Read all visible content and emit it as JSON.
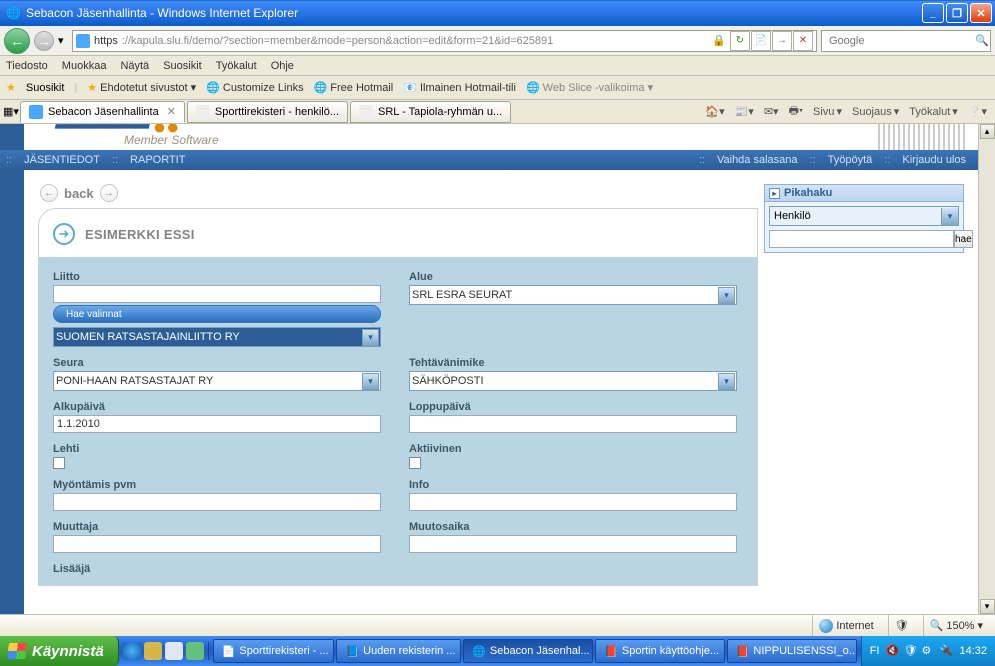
{
  "window": {
    "title": "Sebacon Jäsenhallinta - Windows Internet Explorer"
  },
  "addressbar": {
    "prefix": "https",
    "url": "://kapula.slu.fi/demo/?section=member&mode=person&action=edit&form=21&id=625891"
  },
  "searchbox": {
    "placeholder": "Google"
  },
  "ie_menu": [
    "Tiedosto",
    "Muokkaa",
    "Näytä",
    "Suosikit",
    "Työkalut",
    "Ohje"
  ],
  "favbar": {
    "label": "Suosikit",
    "items": [
      "Ehdotetut sivustot ▾",
      "Customize Links",
      "Free Hotmail",
      "Ilmainen Hotmail-tili",
      "Web Slice -valikoima ▾"
    ]
  },
  "tabs": [
    {
      "label": "Sebacon Jäsenhallinta",
      "active": true
    },
    {
      "label": "Sporttirekisteri - henkilö...",
      "active": false
    },
    {
      "label": "SRL - Tapiola-ryhmän u...",
      "active": false
    }
  ],
  "ie_tools": {
    "sivu": "Sivu",
    "suojaus": "Suojaus",
    "tyokalut": "Työkalut"
  },
  "app_logo_sub": "Member Software",
  "app_menu_left": [
    "JÄSENTIEDOT",
    "RAPORTIT"
  ],
  "app_menu_right": [
    "Vaihda salasana",
    "Työpöytä",
    "Kirjaudu ulos"
  ],
  "back_label": "back",
  "card_title": "ESIMERKKI ESSI",
  "form": {
    "liitto": {
      "label": "Liitto",
      "value": "",
      "hae_btn": "Hae valinnat",
      "select": "SUOMEN RATSASTAJAINLIITTO RY"
    },
    "alue": {
      "label": "Alue",
      "select": "SRL ESRA SEURAT"
    },
    "seura": {
      "label": "Seura",
      "select": "PONI-HAAN RATSASTAJAT RY"
    },
    "tehtavanimike": {
      "label": "Tehtävänimike",
      "select": "SÄHKÖPOSTI"
    },
    "alkupaiva": {
      "label": "Alkupäivä",
      "value": "1.1.2010"
    },
    "loppupaiva": {
      "label": "Loppupäivä",
      "value": ""
    },
    "lehti": {
      "label": "Lehti"
    },
    "aktiivinen": {
      "label": "Aktiivinen"
    },
    "myontamis": {
      "label": "Myöntämis pvm",
      "value": ""
    },
    "info": {
      "label": "Info",
      "value": ""
    },
    "muuttaja": {
      "label": "Muuttaja",
      "value": ""
    },
    "muutosaika": {
      "label": "Muutosaika",
      "value": ""
    },
    "lisaaja": {
      "label": "Lisääjä"
    }
  },
  "pikahaku": {
    "title": "Pikahaku",
    "select": "Henkilö",
    "search_btn": "hae"
  },
  "statusbar": {
    "zone": "Internet",
    "zoom": "150%"
  },
  "taskbar": {
    "start": "Käynnistä",
    "tasks": [
      "Sporttirekisteri - ...",
      "Uuden rekisterin ...",
      "Sebacon Jäsenhal...",
      "Sportin käyttöohje...",
      "NIPPULISENSSI_o..."
    ],
    "lang": "FI",
    "clock": "14:32"
  }
}
